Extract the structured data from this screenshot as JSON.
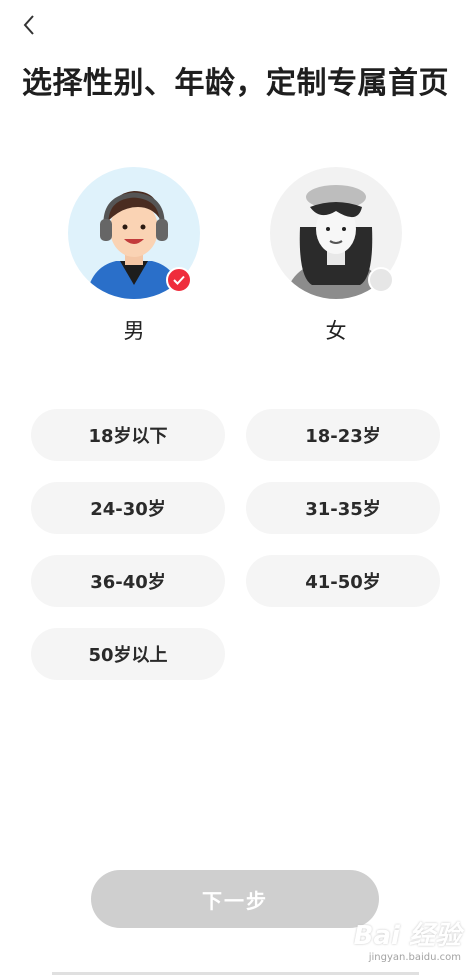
{
  "header": {
    "back_icon": "chevron-left-icon",
    "title": "选择性别、年龄，定制专属首页"
  },
  "genders": [
    {
      "label": "男",
      "selected": true,
      "avatar": "male-avatar",
      "check_color": "#ef2d3c"
    },
    {
      "label": "女",
      "selected": false,
      "avatar": "female-avatar",
      "check_color": "#e6e6e6"
    }
  ],
  "age_ranges": [
    "18岁以下",
    "18-23岁",
    "24-30岁",
    "31-35岁",
    "36-40岁",
    "41-50岁",
    "50岁以上"
  ],
  "next_button": {
    "label": "下一步",
    "enabled": false
  },
  "watermark": {
    "text": "Bai 经验",
    "sub": "jingyan.baidu.com"
  },
  "colors": {
    "accent": "#ef2d3c",
    "chip_bg": "#f5f5f5",
    "button_disabled": "#cfcfcf"
  }
}
